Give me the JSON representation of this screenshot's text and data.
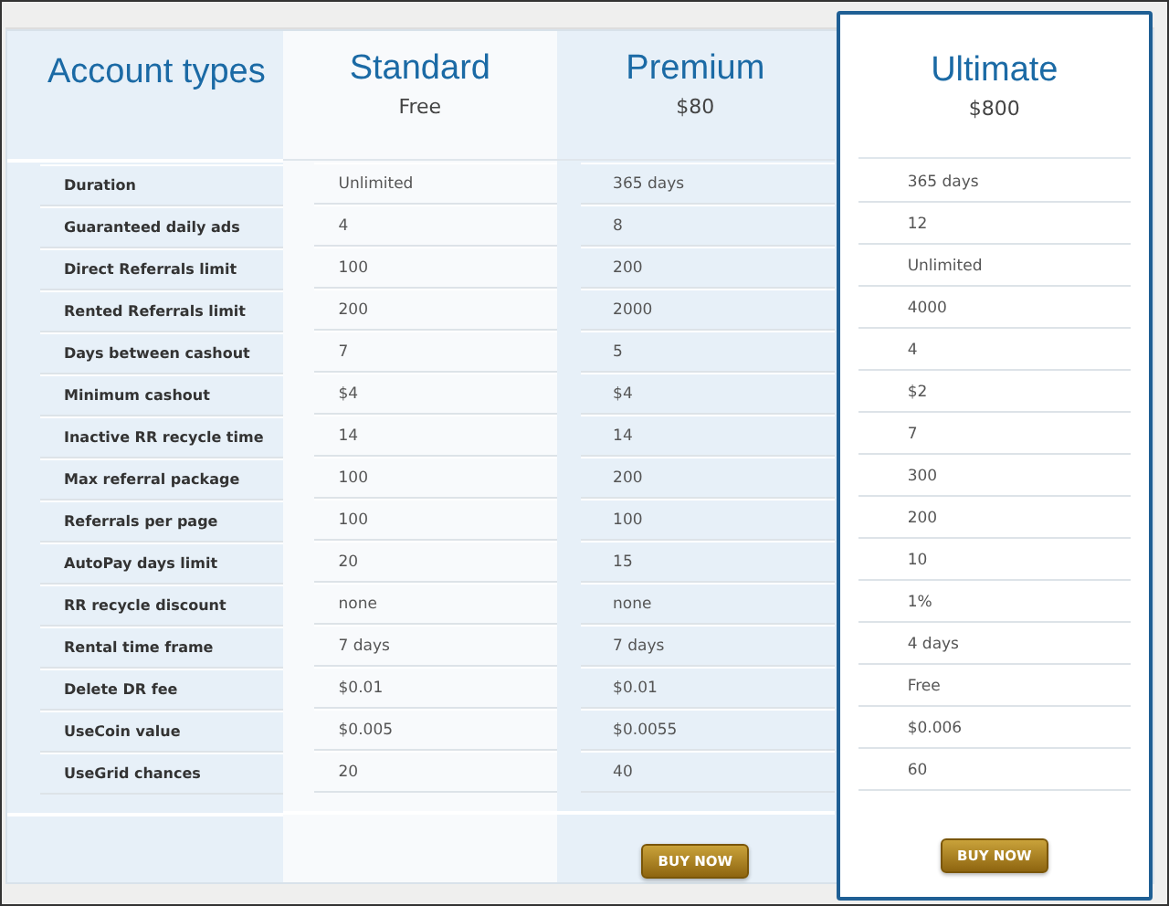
{
  "header_title": "Account types",
  "features": [
    "Duration",
    "Guaranteed daily ads",
    "Direct Referrals limit",
    "Rented Referrals limit",
    "Days between cashout",
    "Minimum cashout",
    "Inactive RR recycle time",
    "Max referral package",
    "Referrals per page",
    "AutoPay days limit",
    "RR recycle discount",
    "Rental time frame",
    "Delete DR fee",
    "UseCoin value",
    "UseGrid chances"
  ],
  "plans": [
    {
      "name": "Standard",
      "price": "Free",
      "selected": false,
      "values": [
        "Unlimited",
        "4",
        "100",
        "200",
        "7",
        "$4",
        "14",
        "100",
        "100",
        "20",
        "none",
        "7 days",
        "$0.01",
        "$0.005",
        "20"
      ]
    },
    {
      "name": "Premium",
      "price": "$80",
      "selected": false,
      "button": "BUY NOW",
      "values": [
        "365 days",
        "8",
        "200",
        "2000",
        "5",
        "$4",
        "14",
        "200",
        "100",
        "15",
        "none",
        "7 days",
        "$0.01",
        "$0.0055",
        "40"
      ]
    },
    {
      "name": "Ultimate",
      "price": "$800",
      "selected": true,
      "button": "BUY NOW",
      "values": [
        "365 days",
        "12",
        "Unlimited",
        "4000",
        "4",
        "$2",
        "7",
        "300",
        "200",
        "10",
        "1%",
        "4 days",
        "Free",
        "$0.006",
        "60"
      ]
    }
  ]
}
